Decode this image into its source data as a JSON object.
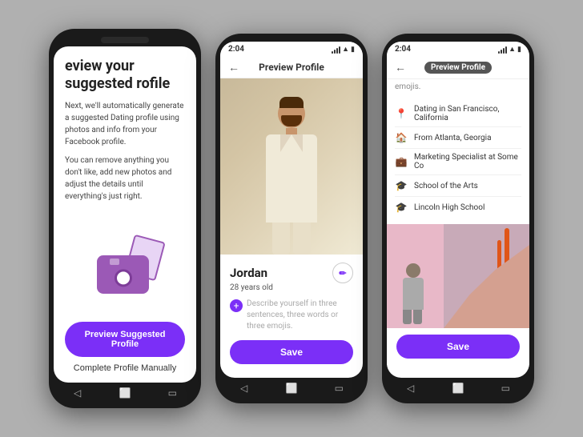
{
  "phone1": {
    "title": "eview your suggested rofile",
    "body1": "Next, we'll automatically generate a suggested Dating profile using photos and info from your Facebook profile.",
    "body2": "You can remove anything you don't like, add new photos and adjust the details until everything's just right.",
    "btn_primary": "Preview Suggested Profile",
    "btn_secondary": "Complete Profile Manually"
  },
  "phone2": {
    "status_time": "2:04",
    "header_title": "Preview Profile",
    "name": "Jordan",
    "age": "28 years old",
    "describe_placeholder": "Describe yourself in three sentences, three words or three emojis.",
    "save_label": "Save"
  },
  "phone3": {
    "status_time": "2:04",
    "header_title": "Preview Profile",
    "top_label": "emojis.",
    "info_rows": [
      {
        "icon": "📍",
        "text": "Dating in San Francisco, California"
      },
      {
        "icon": "🏠",
        "text": "From Atlanta, Georgia"
      },
      {
        "icon": "💼",
        "text": "Marketing Specialist at Some Co"
      },
      {
        "icon": "🎓",
        "text": "School of the Arts"
      },
      {
        "icon": "🎓",
        "text": "Lincoln High School"
      }
    ],
    "save_label": "Save"
  }
}
